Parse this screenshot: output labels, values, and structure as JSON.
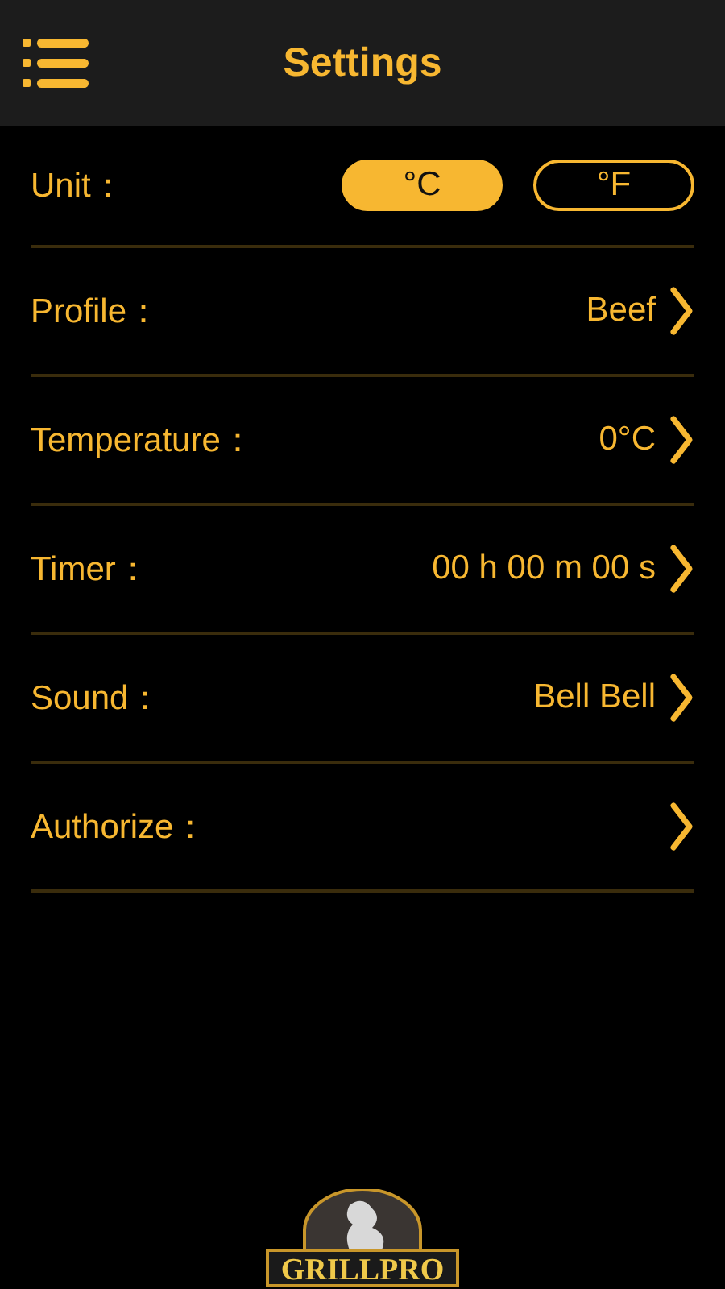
{
  "header": {
    "title": "Settings"
  },
  "unit": {
    "label": "Unit：",
    "options": [
      {
        "label": "°C",
        "selected": true
      },
      {
        "label": "°F",
        "selected": false
      }
    ]
  },
  "settings": [
    {
      "label": "Profile：",
      "value": "Beef"
    },
    {
      "label": "Temperature：",
      "value": "0°C"
    },
    {
      "label": "Timer：",
      "value": "00 h 00 m 00 s"
    },
    {
      "label": "Sound：",
      "value": "Bell Bell"
    },
    {
      "label": "Authorize："
    }
  ],
  "logo": {
    "text": "GRILLPRO"
  }
}
